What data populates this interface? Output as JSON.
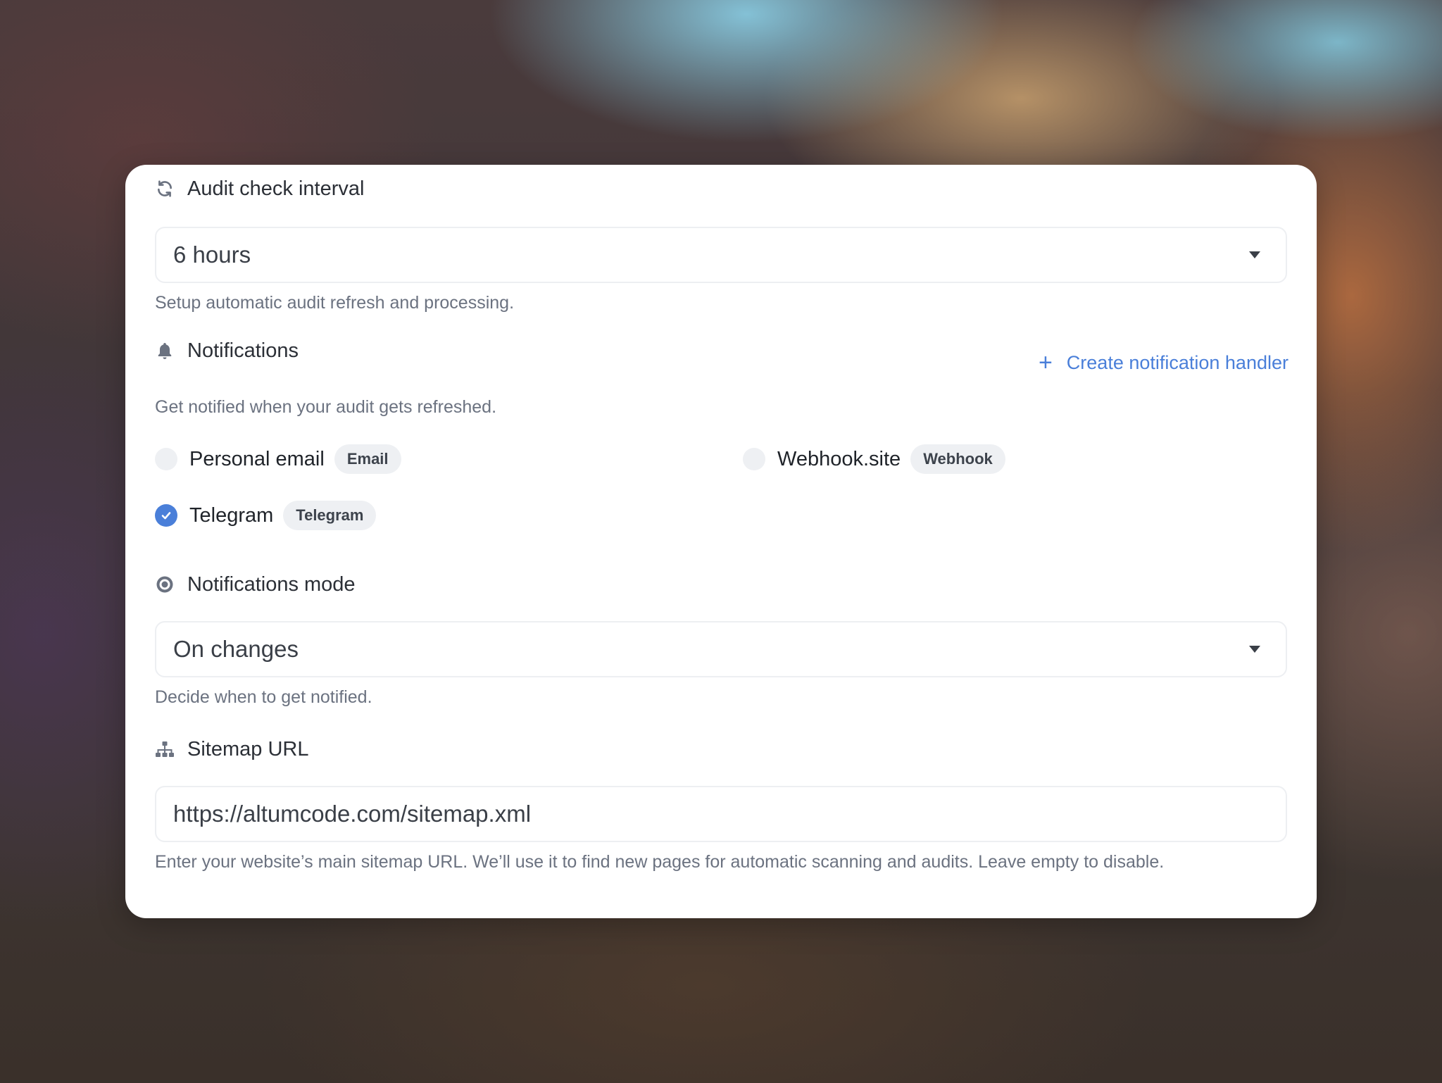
{
  "audit_interval": {
    "label": "Audit check interval",
    "icon": "sync-icon",
    "selected": "6 hours",
    "help": "Setup automatic audit refresh and processing."
  },
  "notifications": {
    "label": "Notifications",
    "icon": "bell-icon",
    "create_link": "Create notification handler",
    "help": "Get notified when your audit gets refreshed.",
    "handlers": [
      {
        "name": "Personal email",
        "badge": "Email",
        "checked": false
      },
      {
        "name": "Webhook.site",
        "badge": "Webhook",
        "checked": false
      },
      {
        "name": "Telegram",
        "badge": "Telegram",
        "checked": true
      }
    ]
  },
  "notifications_mode": {
    "label": "Notifications mode",
    "icon": "dot-circle-icon",
    "selected": "On changes",
    "help": "Decide when to get notified."
  },
  "sitemap": {
    "label": "Sitemap URL",
    "icon": "sitemap-icon",
    "value": "https://altumcode.com/sitemap.xml",
    "help": "Enter your website’s main sitemap URL. We’ll use it to find new pages for automatic scanning and audits. Leave empty to disable."
  },
  "colors": {
    "accent": "#4a7fd9",
    "text": "#2b2f36",
    "muted": "#6b7280",
    "badge_bg": "#eef0f3"
  }
}
